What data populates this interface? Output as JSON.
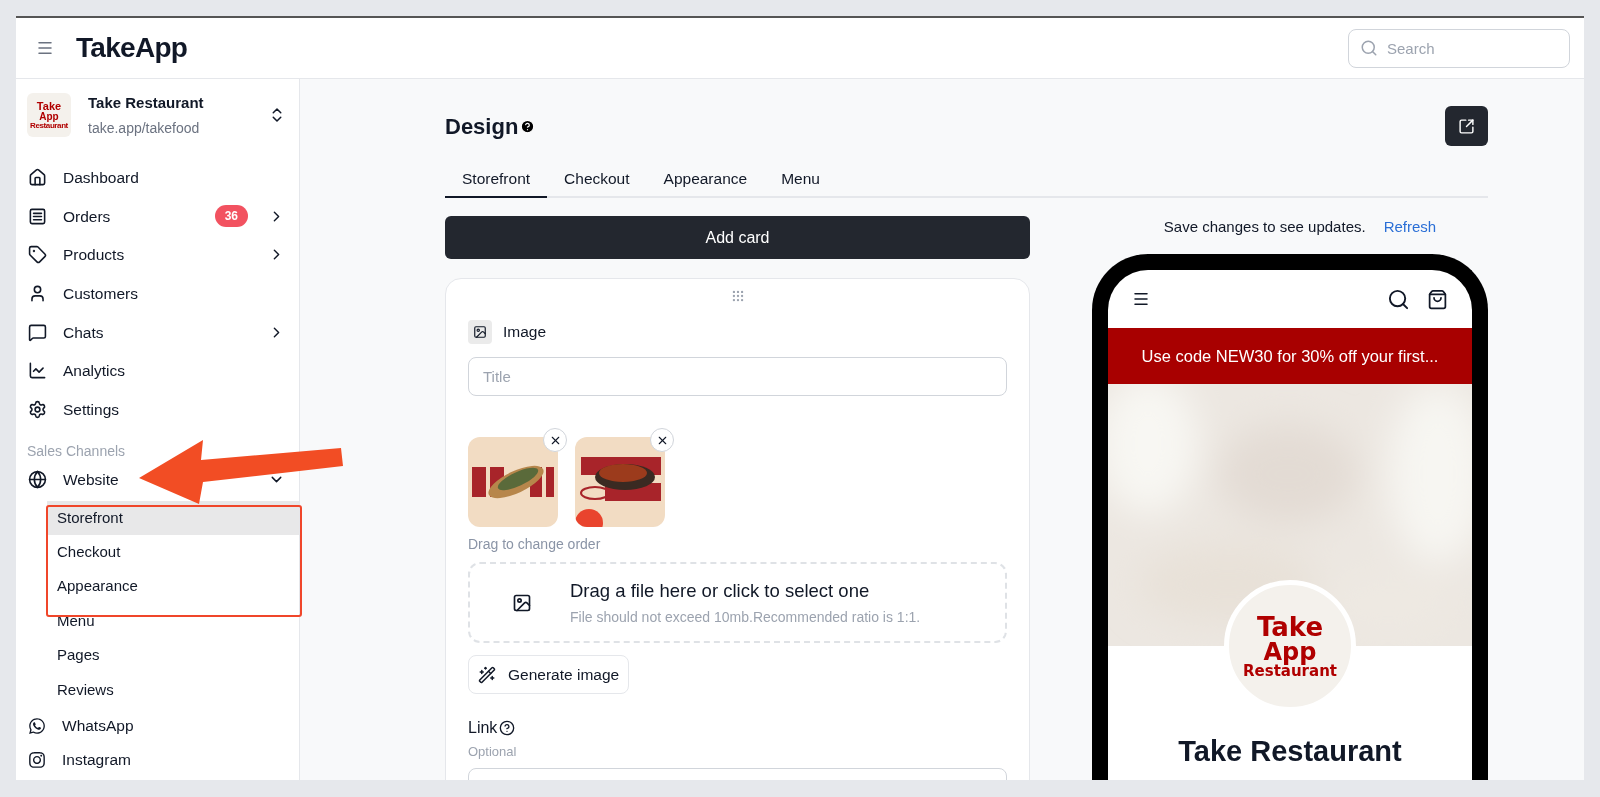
{
  "header": {
    "logo": "TakeApp",
    "search": {
      "placeholder": "Search"
    }
  },
  "store": {
    "name": "Take Restaurant",
    "url": "take.app/takefood",
    "logo_lines": [
      "Take",
      "App",
      "Restaurant"
    ]
  },
  "nav": [
    {
      "kind": "link",
      "label": "Dashboard"
    },
    {
      "kind": "group",
      "label": "Orders",
      "badge": "36",
      "expanded": false
    },
    {
      "kind": "group",
      "label": "Products",
      "expanded": false
    },
    {
      "kind": "link",
      "label": "Customers"
    },
    {
      "kind": "group",
      "label": "Chats",
      "expanded": false
    },
    {
      "kind": "link",
      "label": "Analytics"
    },
    {
      "kind": "link",
      "label": "Settings"
    }
  ],
  "section_title": "Sales Channels",
  "channels": [
    {
      "kind": "group",
      "label": "Website",
      "expanded": true,
      "children": [
        {
          "label": "Storefront",
          "selected": true
        },
        {
          "label": "Checkout",
          "selected": false
        },
        {
          "label": "Appearance",
          "selected": false
        },
        {
          "label": "Menu",
          "selected": false
        },
        {
          "label": "Pages",
          "selected": false
        },
        {
          "label": "Reviews",
          "selected": false
        }
      ]
    },
    {
      "kind": "link",
      "label": "WhatsApp"
    },
    {
      "kind": "link",
      "label": "Instagram"
    }
  ],
  "page": {
    "title": "Design",
    "tabs": [
      {
        "label": "Storefront",
        "selected": true
      },
      {
        "label": "Checkout",
        "selected": false
      },
      {
        "label": "Appearance",
        "selected": false
      },
      {
        "label": "Menu",
        "selected": false
      }
    ],
    "add_button": "Add card",
    "card": {
      "type_label": "Image",
      "title_placeholder": "Title",
      "drag_hint": "Drag to change order",
      "dropzone": {
        "title": "Drag a file here or click to select one",
        "hint": "File should not exceed 10mb.Recommended ratio is 1:1."
      },
      "generate_button": "Generate image",
      "link": {
        "label": "Link",
        "hint": "Optional"
      }
    }
  },
  "preview": {
    "notice": "Save changes to see updates.",
    "refresh": "Refresh",
    "banner": "Use code NEW30 for 30% off your first...",
    "logo_lines": [
      "Take",
      "App",
      "Restaurant"
    ],
    "store_name": "Take Restaurant"
  }
}
